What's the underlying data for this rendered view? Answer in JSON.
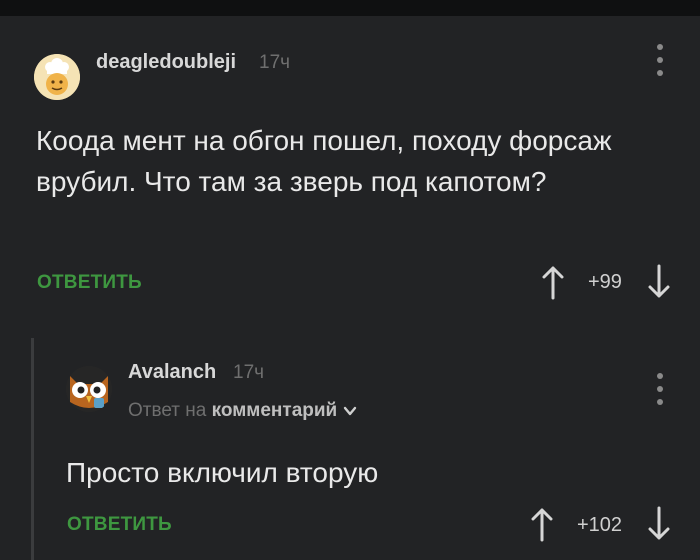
{
  "comments": [
    {
      "username": "deagledoubleji",
      "time": "17ч",
      "text": "Коода мент на обгон пошел, походу форсаж врубил. Что там за зверь под капотом?",
      "reply_label": "ОТВЕТИТЬ",
      "rating": "+99",
      "avatar": "chef-emoji-avatar"
    },
    {
      "username": "Avalanch",
      "time": "17ч",
      "reply_to_prefix": "Ответ на",
      "reply_to_link": "комментарий",
      "text": "Просто включил вторую",
      "reply_label": "ОТВЕТИТЬ",
      "rating": "+102",
      "avatar": "owl-avatar"
    }
  ],
  "colors": {
    "background": "#222325",
    "accent": "#3e9740",
    "muted": "#6f6f6f"
  },
  "icons": [
    "more-vertical-icon",
    "arrow-up-icon",
    "arrow-down-icon",
    "chevron-down-icon"
  ]
}
